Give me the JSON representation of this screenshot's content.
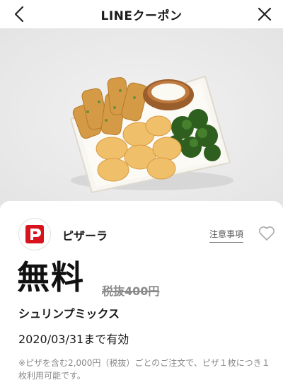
{
  "header": {
    "title": "LINEクーポン"
  },
  "hero": {
    "image_desc": "shrimp-and-potato-platter"
  },
  "coupon": {
    "brand": "ピザーラ",
    "notice_link": "注意事項",
    "discount": "無料",
    "original_price": "税抜400円",
    "product_name": "シュリンプミックス",
    "expiry_date": "2020/03/31",
    "expiry_suffix": "まで有効",
    "note": "※ピザを含む2,000円（税抜）ごとのご注文で、ピザ１枚につき１枚利用可能です。"
  },
  "colors": {
    "brand_red": "#d7141e",
    "text_gray": "#8a8a8a"
  }
}
